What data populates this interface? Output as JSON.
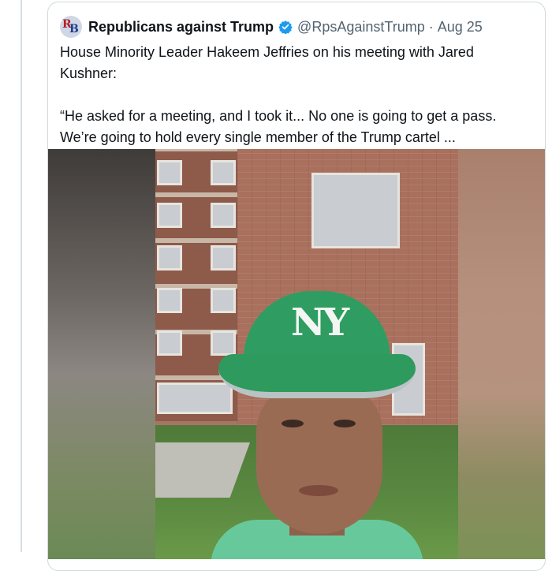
{
  "tweet": {
    "display_name": "Republicans against Trump",
    "handle": "@RpsAgainstTrump",
    "separator": "·",
    "date": "Aug 25",
    "avatar_letters": {
      "first": "R",
      "second": "B"
    },
    "text_paragraphs": [
      "House Minority Leader Hakeem Jeffries on his meeting with Jared Kushner:",
      "“He asked for a meeting, and I took it... No one is going to get a pass. We’re going to hold every single member of the Trump cartel ..."
    ],
    "media": {
      "cap_logo": "NY"
    }
  },
  "icons": {
    "verified": "verified-badge-icon"
  },
  "colors": {
    "text_primary": "#0f1419",
    "text_secondary": "#536471",
    "verified_blue": "#1d9bf0",
    "card_border": "#cfd9de"
  }
}
